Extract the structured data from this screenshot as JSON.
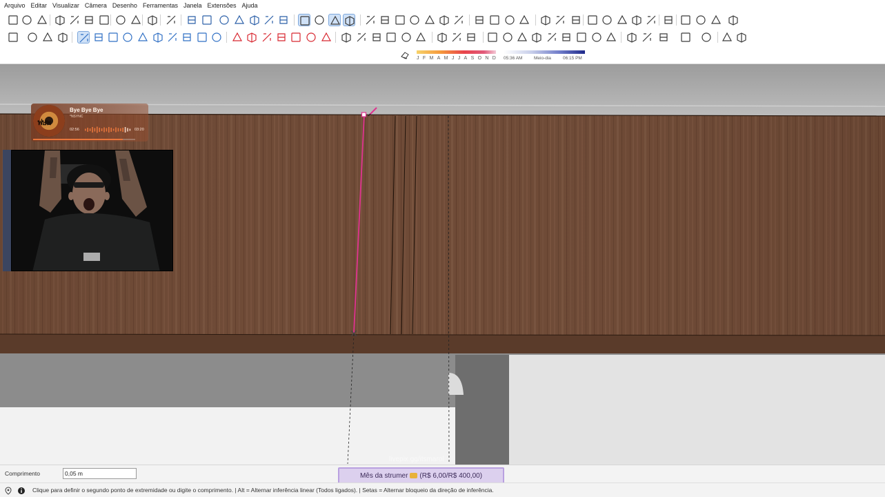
{
  "menu": [
    "Arquivo",
    "Editar",
    "Visualizar",
    "Câmera",
    "Desenho",
    "Ferramentas",
    "Janela",
    "Extensões",
    "Ajuda"
  ],
  "shadow_settings": {
    "months": [
      "J",
      "F",
      "M",
      "A",
      "M",
      "J",
      "J",
      "A",
      "S",
      "O",
      "N",
      "D"
    ],
    "sunrise": "05:36 AM",
    "midday": "Meio-dia",
    "sunset": "06:15 PM"
  },
  "music_player": {
    "title": "Bye Bye Bye",
    "artist": "*NSYNC",
    "current_time": "02:56",
    "total_time": "03:20",
    "progress": 0.88,
    "accent_color": "#e8763c"
  },
  "measurements": {
    "label": "Comprimento",
    "value": "0,05 m"
  },
  "overlay": {
    "watermark": "livepix.gg/itsmarol",
    "goal_text": "Mês da strumer",
    "goal_amount": "(R$ 6,00/R$ 400,00)"
  },
  "status": {
    "hint": "Clique para definir o segundo ponto de extremidade ou digite o comprimento. | Alt = Alternar inferência linear (Todos ligados). | Setas = Alternar bloqueio da direção de inferência."
  },
  "colors": {
    "inference_magenta": "#e0338f",
    "wood": "#6e4a36",
    "toolbar_active": "#cfe1f7"
  }
}
